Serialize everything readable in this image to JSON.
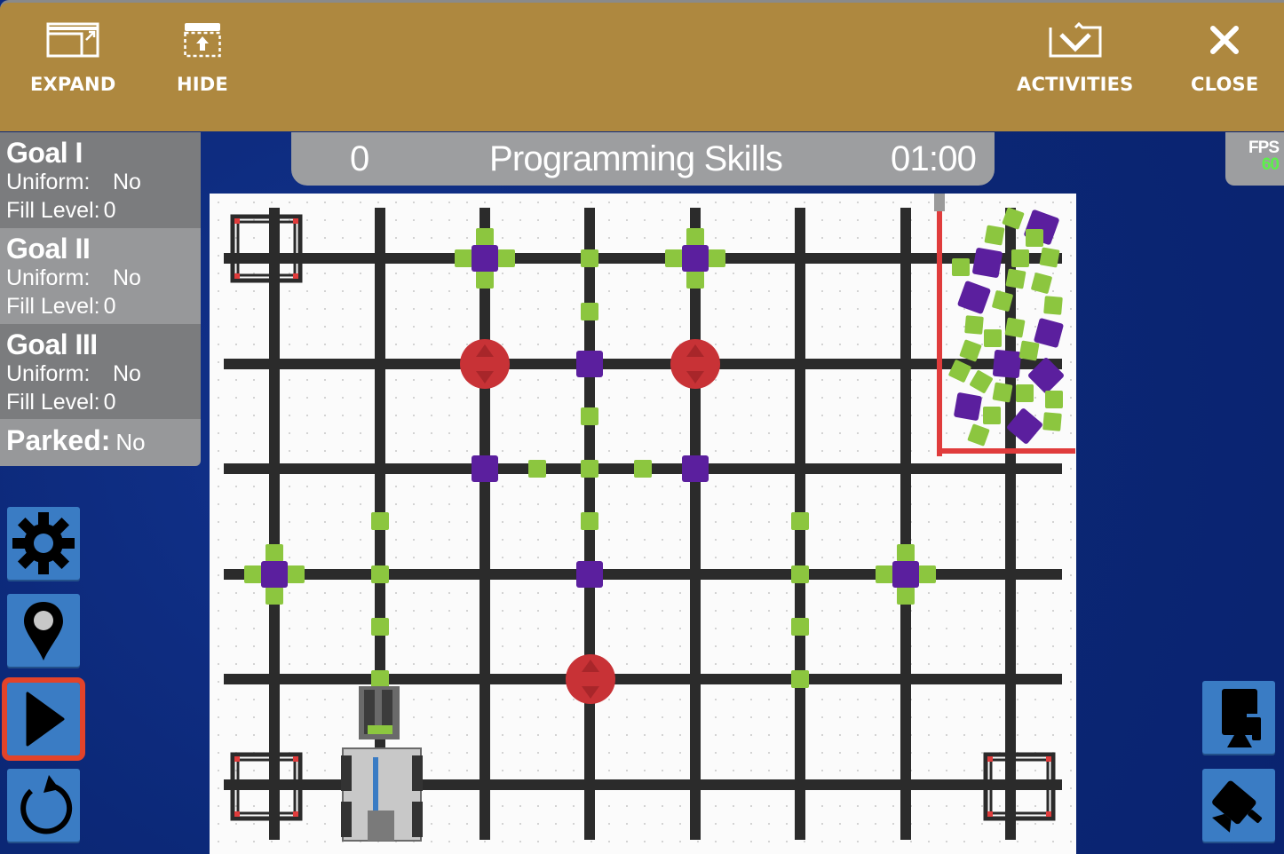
{
  "toolbar": {
    "expand_label": "EXPAND",
    "hide_label": "HIDE",
    "activities_label": "ACTIVITIES",
    "close_label": "CLOSE",
    "color": "#ae883f"
  },
  "goals": [
    {
      "title": "Goal I",
      "uniform_label": "Uniform:",
      "uniform_value": "No",
      "fill_label": "Fill Level:",
      "fill_value": "0"
    },
    {
      "title": "Goal II",
      "uniform_label": "Uniform:",
      "uniform_value": "No",
      "fill_label": "Fill Level:",
      "fill_value": "0"
    },
    {
      "title": "Goal III",
      "uniform_label": "Uniform:",
      "uniform_value": "No",
      "fill_label": "Fill Level:",
      "fill_value": "0"
    }
  ],
  "parked": {
    "label": "Parked:",
    "value": "No"
  },
  "scoreboard": {
    "score": "0",
    "mode": "Programming Skills",
    "timer": "01:00"
  },
  "fps": {
    "label": "FPS",
    "value": "60",
    "value_color": "#5cf14a"
  },
  "left_controls": [
    {
      "name": "settings",
      "icon": "gear-icon"
    },
    {
      "name": "position",
      "icon": "map-pin-icon"
    },
    {
      "name": "play",
      "icon": "play-icon",
      "selected": true
    },
    {
      "name": "reset",
      "icon": "reset-icon"
    }
  ],
  "right_controls": [
    {
      "name": "top-camera",
      "icon": "camera-top-icon"
    },
    {
      "name": "angled-camera",
      "icon": "camera-angled-icon"
    }
  ],
  "field": {
    "colors": {
      "line": "#2b2b2b",
      "purple": "#5b1f9e",
      "green": "#8cc63f",
      "red": "#c83236",
      "tape": "#e03c3c"
    }
  }
}
